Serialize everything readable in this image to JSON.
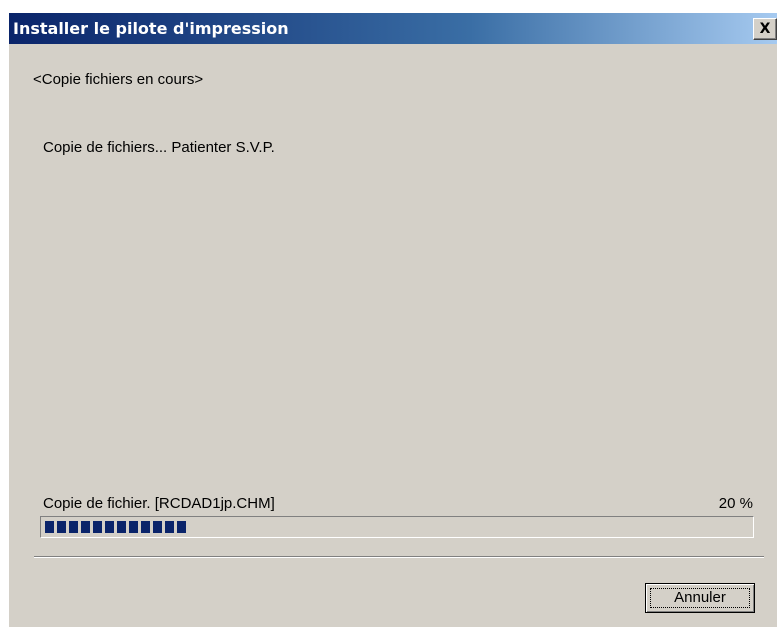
{
  "window": {
    "title": "Installer le pilote d'impression",
    "close_label": "X"
  },
  "content": {
    "status_heading": "<Copie fichiers en cours>",
    "message": "Copie de fichiers... Patienter S.V.P."
  },
  "progress": {
    "file_label": "Copie de fichier. [RCDAD1jp.CHM]",
    "percent_text": "20 %",
    "fraction": 0.2,
    "bar_color": "#0a246a"
  },
  "buttons": {
    "cancel_label": "Annuler"
  },
  "colors": {
    "dialog_face": "#d4d0c8",
    "titlebar_start": "#0a246a",
    "titlebar_end": "#a6caf0"
  }
}
